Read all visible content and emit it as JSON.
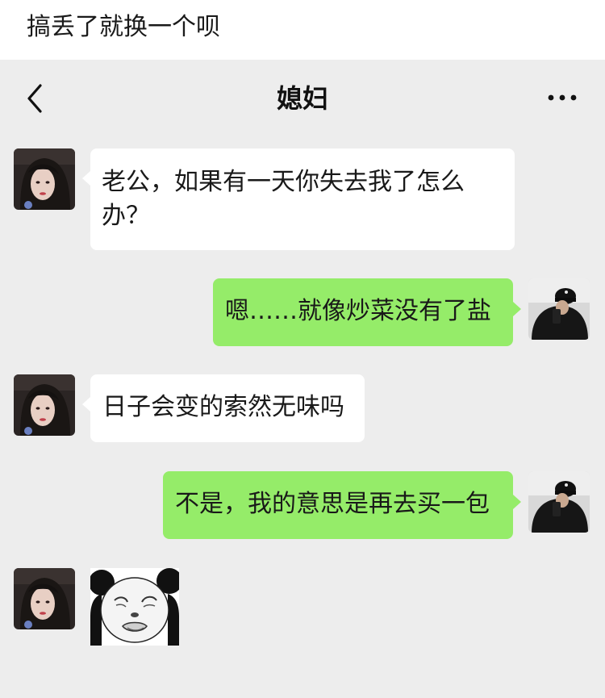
{
  "caption": {
    "text": "搞丢了就换一个呗"
  },
  "header": {
    "title": "媳妇",
    "back_icon": "chevron-left-icon",
    "more_icon": "ellipsis-icon"
  },
  "colors": {
    "chat_background": "#ededed",
    "incoming_bubble": "#ffffff",
    "outgoing_bubble": "#95ec69"
  },
  "messages": [
    {
      "sender": "contact",
      "type": "text",
      "text": "老公，如果有一天你失去我了怎么办？"
    },
    {
      "sender": "me",
      "type": "text",
      "text": "嗯……就像炒菜没有了盐"
    },
    {
      "sender": "contact",
      "type": "text",
      "text": "日子会变的索然无味吗"
    },
    {
      "sender": "me",
      "type": "text",
      "text": "不是，我的意思是再去买一包"
    },
    {
      "sender": "contact",
      "type": "sticker",
      "sticker": "panda-face-sticker"
    }
  ]
}
